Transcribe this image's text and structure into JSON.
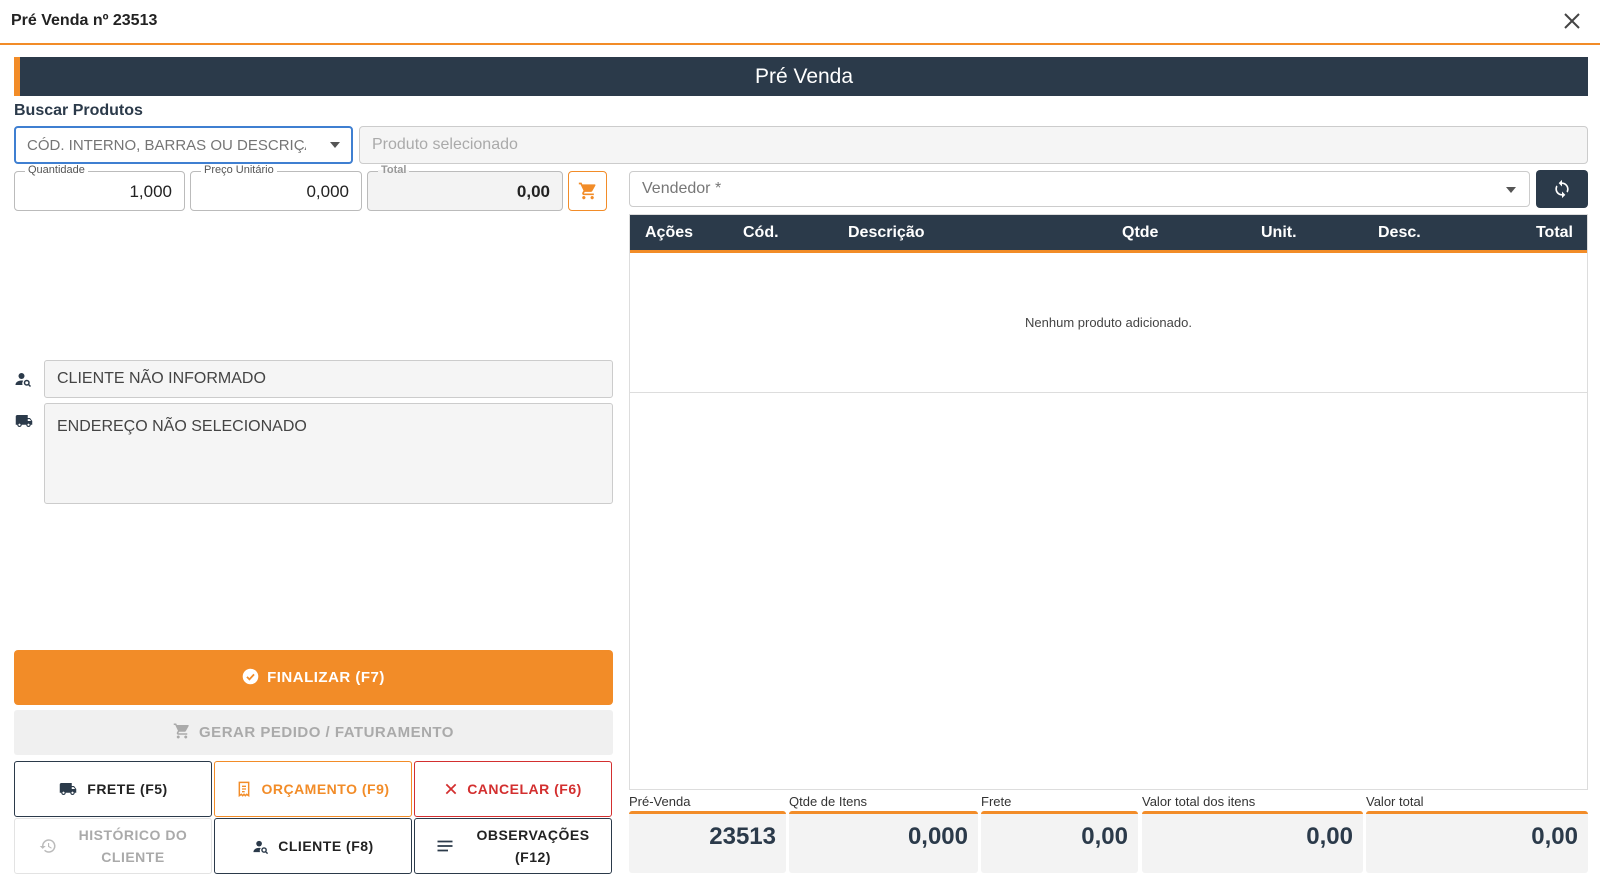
{
  "dialog": {
    "title": "Pré Venda nº 23513"
  },
  "banner": {
    "title": "Pré Venda"
  },
  "search": {
    "label": "Buscar Produtos",
    "placeholder": "CÓD. INTERNO, BARRAS OU DESCRIÇÃO",
    "selected_placeholder": "Produto selecionado"
  },
  "fields": {
    "quantidade": {
      "label": "Quantidade",
      "value": "1,000"
    },
    "preco": {
      "label": "Preço Unitário",
      "value": "0,000"
    },
    "total": {
      "label": "Total",
      "value": "0,00"
    }
  },
  "vendor": {
    "placeholder": "Vendedor *"
  },
  "table": {
    "columns": [
      "Ações",
      "Cód.",
      "Descrição",
      "Qtde",
      "Unit.",
      "Desc.",
      "Total"
    ],
    "empty_text": "Nenhum produto adicionado."
  },
  "client": {
    "name": "CLIENTE NÃO INFORMADO",
    "address": "ENDEREÇO NÃO SELECIONADO"
  },
  "buttons": {
    "finalizar": "FINALIZAR (F7)",
    "gerar": "GERAR PEDIDO / FATURAMENTO",
    "frete": "FRETE (F5)",
    "orcamento": "ORÇAMENTO (F9)",
    "cancelar": "CANCELAR (F6)",
    "historico_line1": "HISTÓRICO DO",
    "historico_line2": "CLIENTE",
    "cliente": "CLIENTE (F8)",
    "observacoes_line1": "OBSERVAÇÕES",
    "observacoes_line2": "(F12)"
  },
  "summary": [
    {
      "label": "Pré-Venda",
      "value": "23513"
    },
    {
      "label": "Qtde de Itens",
      "value": "0,000"
    },
    {
      "label": "Frete",
      "value": "0,00"
    },
    {
      "label": "Valor total dos itens",
      "value": "0,00"
    },
    {
      "label": "Valor total",
      "value": "0,00"
    }
  ],
  "colors": {
    "accent": "#f28c28",
    "dark": "#2b3a4a",
    "danger": "#d32f2f"
  },
  "icons": [
    "close-icon",
    "cart-icon",
    "refresh-icon",
    "person-search-icon",
    "truck-icon",
    "check-circle-icon",
    "receipt-icon",
    "x-icon",
    "history-icon",
    "notes-icon"
  ]
}
